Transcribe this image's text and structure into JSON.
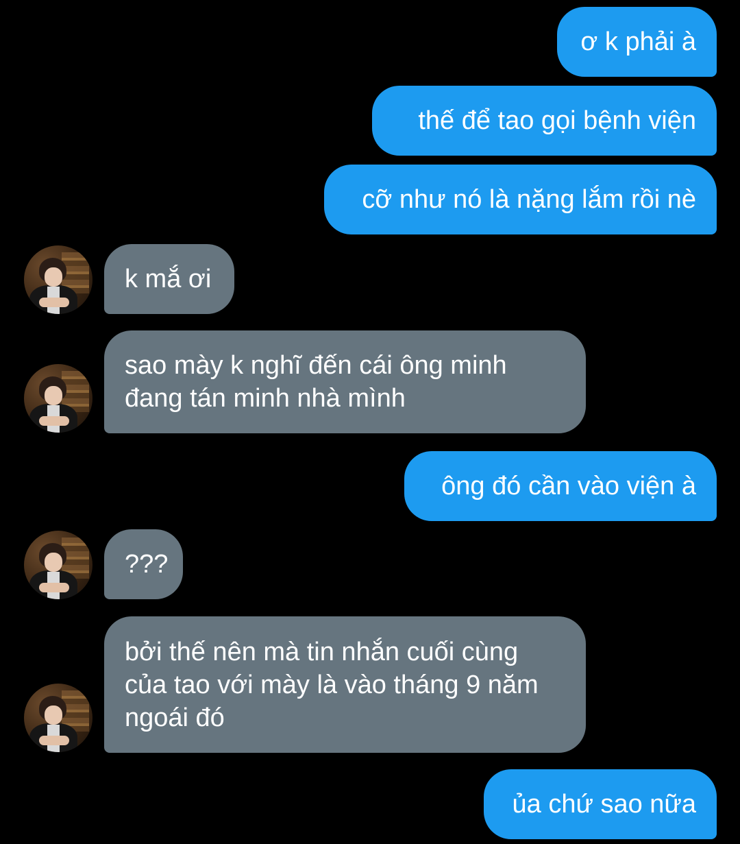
{
  "messages": [
    {
      "side": "sent",
      "text": "ơ k phải à"
    },
    {
      "side": "sent",
      "text": "thế để tao gọi bệnh viện"
    },
    {
      "side": "sent",
      "text": "cỡ như nó là nặng lắm rồi nè"
    },
    {
      "side": "received",
      "text": "k mắ ơi"
    },
    {
      "side": "received",
      "text": "sao mày k nghĩ đến cái ông minh đang tán minh nhà mình"
    },
    {
      "side": "sent",
      "text": "ông đó cần vào viện à"
    },
    {
      "side": "received",
      "text": "???"
    },
    {
      "side": "received",
      "text": "bởi thế nên mà tin nhắn cuối cùng của tao với mày là vào tháng 9 năm ngoái đó"
    },
    {
      "side": "sent",
      "text": "ủa chứ sao nữa"
    }
  ],
  "colors": {
    "background": "#000000",
    "sent_bubble": "#1d9bf0",
    "received_bubble": "#66757f",
    "text": "#ffffff"
  },
  "icons": {
    "avatar": "avatar-photo"
  }
}
